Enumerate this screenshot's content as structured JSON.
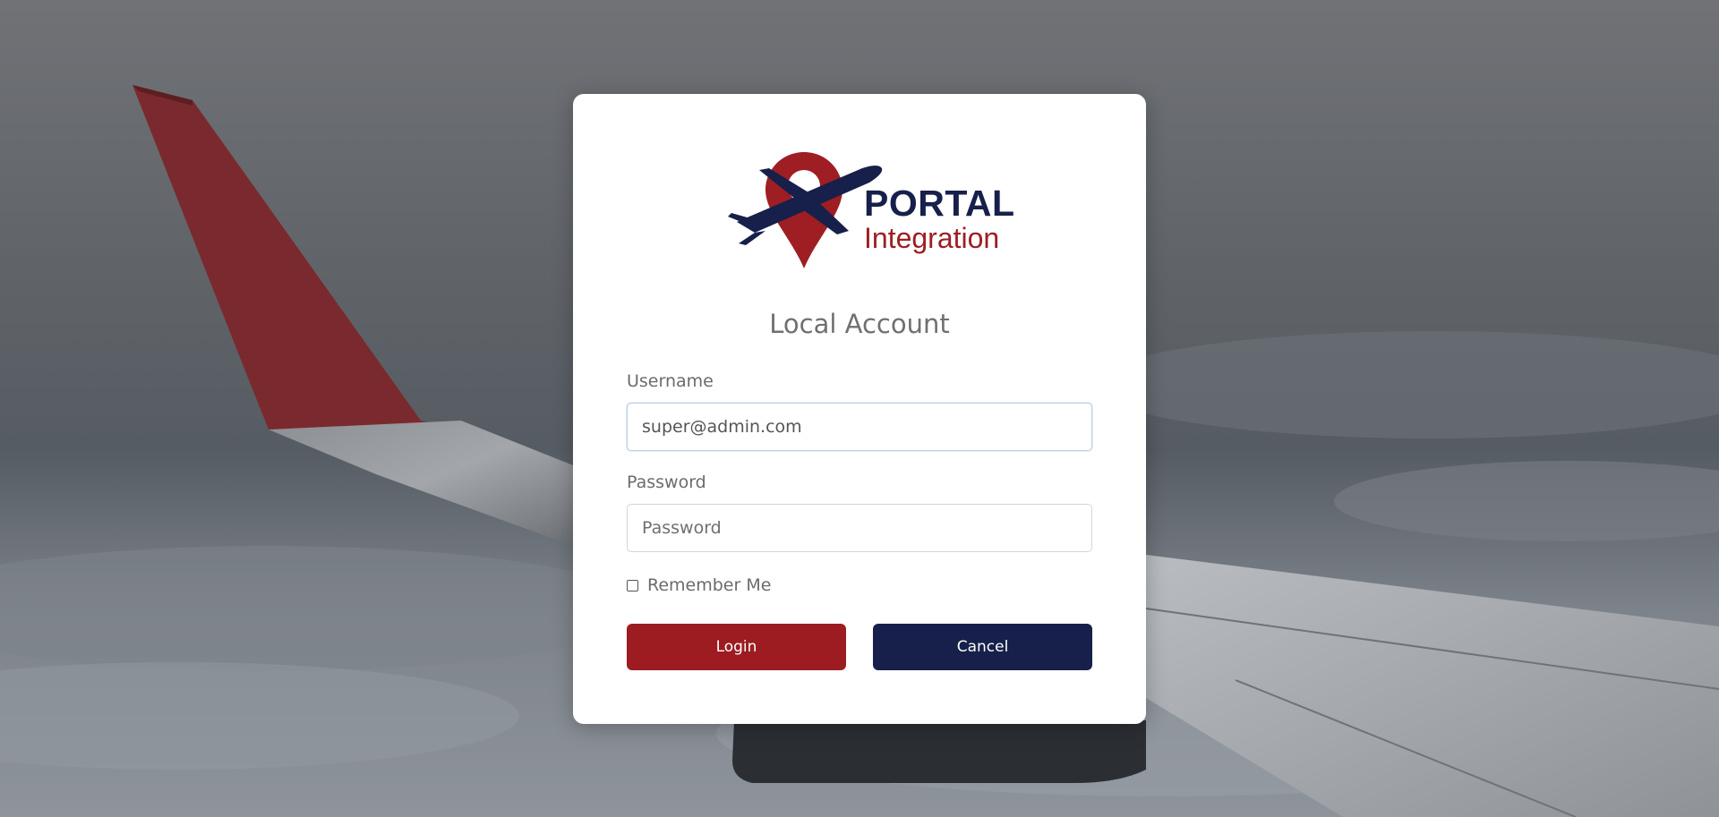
{
  "brand": {
    "name_primary": "PORTAL",
    "name_secondary": "Integration",
    "colors": {
      "navy": "#16204a",
      "red": "#9e1e23"
    }
  },
  "login_card": {
    "title": "Local Account",
    "username": {
      "label": "Username",
      "value": "super@admin.com",
      "placeholder": "Username"
    },
    "password": {
      "label": "Password",
      "value": "",
      "placeholder": "Password"
    },
    "remember_me": {
      "label": "Remember Me",
      "checked": false
    },
    "buttons": {
      "login_label": "Login",
      "cancel_label": "Cancel"
    }
  },
  "background": {
    "scene": "airplane-wing-above-clouds"
  }
}
